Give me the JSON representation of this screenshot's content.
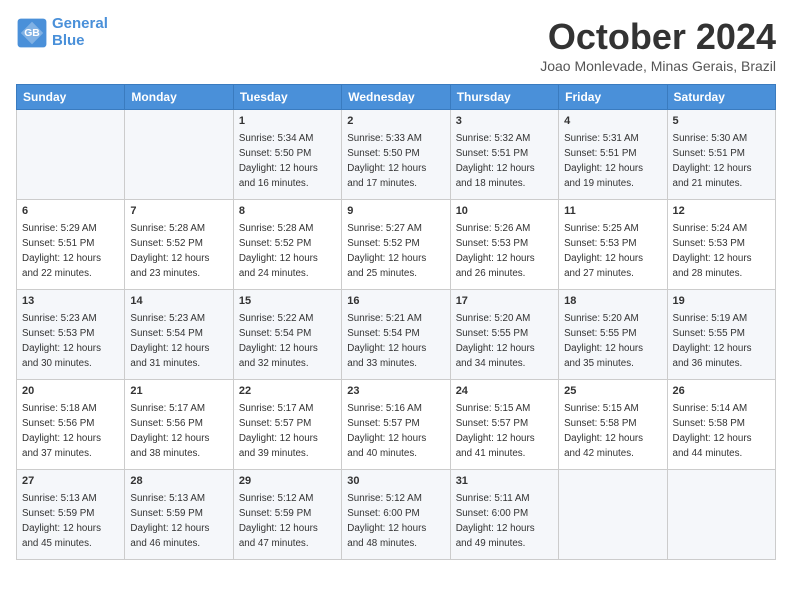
{
  "header": {
    "logo_line1": "General",
    "logo_line2": "Blue",
    "month": "October 2024",
    "location": "Joao Monlevade, Minas Gerais, Brazil"
  },
  "weekdays": [
    "Sunday",
    "Monday",
    "Tuesday",
    "Wednesday",
    "Thursday",
    "Friday",
    "Saturday"
  ],
  "weeks": [
    [
      null,
      null,
      {
        "day": 1,
        "sunrise": "5:34 AM",
        "sunset": "5:50 PM",
        "daylight": "12 hours and 16 minutes."
      },
      {
        "day": 2,
        "sunrise": "5:33 AM",
        "sunset": "5:50 PM",
        "daylight": "12 hours and 17 minutes."
      },
      {
        "day": 3,
        "sunrise": "5:32 AM",
        "sunset": "5:51 PM",
        "daylight": "12 hours and 18 minutes."
      },
      {
        "day": 4,
        "sunrise": "5:31 AM",
        "sunset": "5:51 PM",
        "daylight": "12 hours and 19 minutes."
      },
      {
        "day": 5,
        "sunrise": "5:30 AM",
        "sunset": "5:51 PM",
        "daylight": "12 hours and 21 minutes."
      }
    ],
    [
      {
        "day": 6,
        "sunrise": "5:29 AM",
        "sunset": "5:51 PM",
        "daylight": "12 hours and 22 minutes."
      },
      {
        "day": 7,
        "sunrise": "5:28 AM",
        "sunset": "5:52 PM",
        "daylight": "12 hours and 23 minutes."
      },
      {
        "day": 8,
        "sunrise": "5:28 AM",
        "sunset": "5:52 PM",
        "daylight": "12 hours and 24 minutes."
      },
      {
        "day": 9,
        "sunrise": "5:27 AM",
        "sunset": "5:52 PM",
        "daylight": "12 hours and 25 minutes."
      },
      {
        "day": 10,
        "sunrise": "5:26 AM",
        "sunset": "5:53 PM",
        "daylight": "12 hours and 26 minutes."
      },
      {
        "day": 11,
        "sunrise": "5:25 AM",
        "sunset": "5:53 PM",
        "daylight": "12 hours and 27 minutes."
      },
      {
        "day": 12,
        "sunrise": "5:24 AM",
        "sunset": "5:53 PM",
        "daylight": "12 hours and 28 minutes."
      }
    ],
    [
      {
        "day": 13,
        "sunrise": "5:23 AM",
        "sunset": "5:53 PM",
        "daylight": "12 hours and 30 minutes."
      },
      {
        "day": 14,
        "sunrise": "5:23 AM",
        "sunset": "5:54 PM",
        "daylight": "12 hours and 31 minutes."
      },
      {
        "day": 15,
        "sunrise": "5:22 AM",
        "sunset": "5:54 PM",
        "daylight": "12 hours and 32 minutes."
      },
      {
        "day": 16,
        "sunrise": "5:21 AM",
        "sunset": "5:54 PM",
        "daylight": "12 hours and 33 minutes."
      },
      {
        "day": 17,
        "sunrise": "5:20 AM",
        "sunset": "5:55 PM",
        "daylight": "12 hours and 34 minutes."
      },
      {
        "day": 18,
        "sunrise": "5:20 AM",
        "sunset": "5:55 PM",
        "daylight": "12 hours and 35 minutes."
      },
      {
        "day": 19,
        "sunrise": "5:19 AM",
        "sunset": "5:55 PM",
        "daylight": "12 hours and 36 minutes."
      }
    ],
    [
      {
        "day": 20,
        "sunrise": "5:18 AM",
        "sunset": "5:56 PM",
        "daylight": "12 hours and 37 minutes."
      },
      {
        "day": 21,
        "sunrise": "5:17 AM",
        "sunset": "5:56 PM",
        "daylight": "12 hours and 38 minutes."
      },
      {
        "day": 22,
        "sunrise": "5:17 AM",
        "sunset": "5:57 PM",
        "daylight": "12 hours and 39 minutes."
      },
      {
        "day": 23,
        "sunrise": "5:16 AM",
        "sunset": "5:57 PM",
        "daylight": "12 hours and 40 minutes."
      },
      {
        "day": 24,
        "sunrise": "5:15 AM",
        "sunset": "5:57 PM",
        "daylight": "12 hours and 41 minutes."
      },
      {
        "day": 25,
        "sunrise": "5:15 AM",
        "sunset": "5:58 PM",
        "daylight": "12 hours and 42 minutes."
      },
      {
        "day": 26,
        "sunrise": "5:14 AM",
        "sunset": "5:58 PM",
        "daylight": "12 hours and 44 minutes."
      }
    ],
    [
      {
        "day": 27,
        "sunrise": "5:13 AM",
        "sunset": "5:59 PM",
        "daylight": "12 hours and 45 minutes."
      },
      {
        "day": 28,
        "sunrise": "5:13 AM",
        "sunset": "5:59 PM",
        "daylight": "12 hours and 46 minutes."
      },
      {
        "day": 29,
        "sunrise": "5:12 AM",
        "sunset": "5:59 PM",
        "daylight": "12 hours and 47 minutes."
      },
      {
        "day": 30,
        "sunrise": "5:12 AM",
        "sunset": "6:00 PM",
        "daylight": "12 hours and 48 minutes."
      },
      {
        "day": 31,
        "sunrise": "5:11 AM",
        "sunset": "6:00 PM",
        "daylight": "12 hours and 49 minutes."
      },
      null,
      null
    ]
  ]
}
